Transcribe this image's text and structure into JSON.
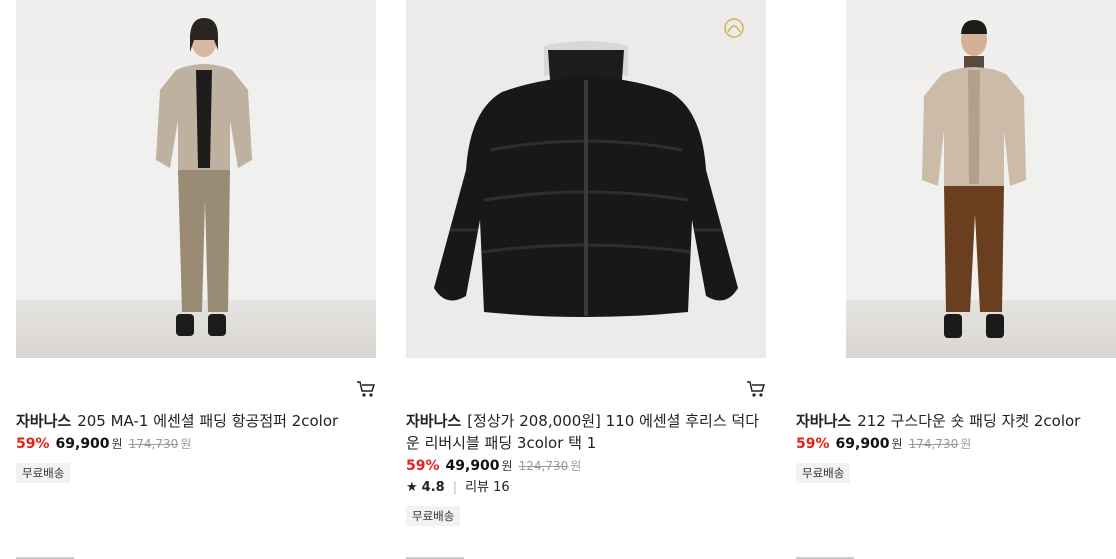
{
  "products": [
    {
      "brand": "자바나스",
      "name": "205 MA-1 에센셜 패딩 항공점퍼 2color",
      "discount": "59%",
      "price": "69,900",
      "currency": "원",
      "original_price": "174,730",
      "badge": "무료배송"
    },
    {
      "brand": "자바나스",
      "name": "[정상가 208,000원] 110 에센셜 후리스 덕다운 리버시블 패딩 3color 택 1",
      "discount": "59%",
      "price": "49,900",
      "currency": "원",
      "original_price": "124,730",
      "rating": "4.8",
      "review_label": "리뷰 16",
      "badge": "무료배송"
    },
    {
      "brand": "자바나스",
      "name": "212 구스다운 숏 패딩 자켓 2color",
      "discount": "59%",
      "price": "69,900",
      "currency": "원",
      "original_price": "174,730",
      "badge": "무료배송"
    }
  ],
  "icons": {
    "cart": "cart-icon",
    "star": "star-icon"
  },
  "colors": {
    "discount": "#e2231a",
    "badge_bg": "#f2f2f2"
  }
}
